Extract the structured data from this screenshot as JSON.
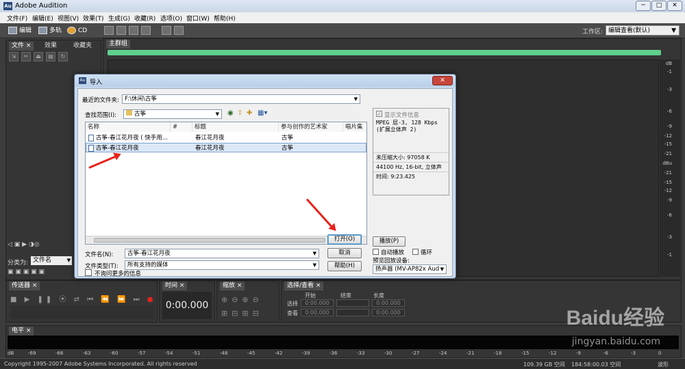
{
  "window": {
    "title": "Adobe Audition",
    "icon_text": "Au",
    "buttons": [
      "─",
      "□",
      "✕"
    ]
  },
  "menu": [
    "文件(F)",
    "编辑(E)",
    "视图(V)",
    "效果(T)",
    "生成(G)",
    "收藏(R)",
    "选项(O)",
    "窗口(W)",
    "帮助(H)"
  ],
  "toolbar": {
    "edit_label": "编辑",
    "multitrack_label": "多轨",
    "cd_label": "CD",
    "workspace_label": "工作区:",
    "workspace_value": "编辑查看(默认)"
  },
  "left_panel": {
    "tabs": [
      "文件 ×",
      "效果",
      "收藏夹"
    ],
    "sort_label": "分类为:",
    "sort_value": "文件名"
  },
  "main_panel": {
    "tab": "主群组",
    "db_labels": [
      "dB",
      "-1",
      "-3",
      "-6",
      "-9",
      "-12",
      "-15",
      "-21",
      "dBu",
      "-21",
      "-15",
      "-12",
      "-9",
      "-6",
      "-3",
      "-1"
    ]
  },
  "dialog": {
    "title": "导入",
    "icon_text": "Au",
    "recent_label": "最近的文件夹:",
    "recent_value": "F:\\休闲\\古筝",
    "lookin_label": "查找范围(I):",
    "lookin_value": "古筝",
    "columns": [
      "名称",
      "#",
      "标题",
      "参与创作的艺术家",
      "唱片集"
    ],
    "files": [
      {
        "name": "古筝-春江花月夜 ( 快手用...",
        "num": "",
        "title": "春江花月夜",
        "artist": "古筝",
        "selected": false
      },
      {
        "name": "古筝-春江花月夜",
        "num": "",
        "title": "春江花月夜",
        "artist": "古筝",
        "selected": true
      }
    ],
    "filename_label": "文件名(N):",
    "filename_value": "古筝-春江花月夜",
    "filetype_label": "文件类型(T):",
    "filetype_value": "所有支持的媒体",
    "no_ask_label": "不询问更多的信息",
    "open_button": "打开(O)",
    "cancel_button": "取消",
    "help_button": "帮助(H)",
    "show_info_label": "显示文件信息",
    "info_format": "MPEG 层-3, 128 Kbps",
    "info_channels": "(扩展立体声 2)",
    "uncompressed_size": "未压缩大小:  97058 K",
    "audio_format": "44100 Hz, 16-bit, 立体声",
    "duration": "时间:     9:23.425",
    "play_button": "播放(P)",
    "autoplay_label": "自动播放",
    "loop_label": "循环",
    "preview_device_label": "预览回放设备:",
    "preview_device_value": "扬声器 (MV-AP82x Audio E"
  },
  "transport": {
    "tab": "传送器 ×"
  },
  "time": {
    "tab": "时间 ×",
    "value": "0:00.000"
  },
  "zoom": {
    "tab": "缩放 ×"
  },
  "selection": {
    "tab": "选择/查看 ×",
    "headers": [
      "开始",
      "结束",
      "长度"
    ],
    "row_labels": [
      "选择",
      "查看"
    ],
    "values": [
      "0:00.000",
      "",
      "0:00.000",
      "0:00.000",
      "",
      "0:00.000"
    ]
  },
  "level": {
    "tab": "电平 ×",
    "scale": [
      "dB",
      "-69",
      "-66",
      "-63",
      "-60",
      "-57",
      "-54",
      "-51",
      "-48",
      "-45",
      "-42",
      "-39",
      "-36",
      "-33",
      "-30",
      "-27",
      "-24",
      "-21",
      "-18",
      "-15",
      "-12",
      "-9",
      "-6",
      "-3",
      "0"
    ]
  },
  "status": {
    "copyright": "Copyright 1995-2007 Adobe Systems Incorporated. All rights reserved",
    "disk_space": "109.39 GB 空间",
    "time_space": "184:58:00.03 空间",
    "view_mode": "波形"
  },
  "watermark": {
    "text": "Baidu经验",
    "url": "jingyan.baidu.com"
  },
  "colors": {
    "accent_green": "#5fd08e",
    "arrow_red": "#e8231c",
    "dialog_frame": "#c7d9ee"
  }
}
